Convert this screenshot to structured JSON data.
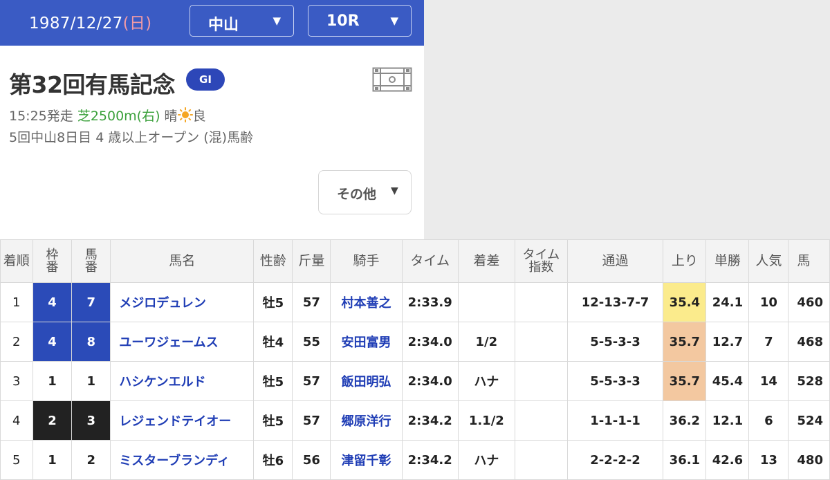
{
  "header": {
    "date": "1987/12/27",
    "day_of_week": "(日)",
    "venue": "中山",
    "race_no": "10R"
  },
  "race": {
    "name": "第32回有馬記念",
    "grade": "GI",
    "start": "15:25発走",
    "course": "芝2500m(右)",
    "weather": "晴",
    "going": "良",
    "meeting": "5回中山8日目 4 歳以上オープン (混)馬齢",
    "other_button": "その他",
    "icons": {
      "video": "film-icon",
      "weather": "sun-icon"
    }
  },
  "table": {
    "headers": [
      "着順",
      "枠番",
      "馬番",
      "馬名",
      "性齢",
      "斤量",
      "騎手",
      "タイム",
      "着差",
      "タイム指数",
      "通過",
      "上り",
      "単勝",
      "人気",
      "馬"
    ],
    "rows": [
      {
        "rank": "1",
        "waku": "4",
        "umaban": "7",
        "horse": "メジロデュレン",
        "sexage": "牡5",
        "weight": "57",
        "jockey": "村本善之",
        "time": "2:33.9",
        "margin": "",
        "index": "",
        "passing": "12-13-7-7",
        "last3f": "35.4",
        "odds": "24.1",
        "popularity": "10",
        "body": "460"
      },
      {
        "rank": "2",
        "waku": "4",
        "umaban": "8",
        "horse": "ユーワジェームス",
        "sexage": "牡4",
        "weight": "55",
        "jockey": "安田富男",
        "time": "2:34.0",
        "margin": "1/2",
        "index": "",
        "passing": "5-5-3-3",
        "last3f": "35.7",
        "odds": "12.7",
        "popularity": "7",
        "body": "468"
      },
      {
        "rank": "3",
        "waku": "1",
        "umaban": "1",
        "horse": "ハシケンエルド",
        "sexage": "牡5",
        "weight": "57",
        "jockey": "飯田明弘",
        "time": "2:34.0",
        "margin": "ハナ",
        "index": "",
        "passing": "5-5-3-3",
        "last3f": "35.7",
        "odds": "45.4",
        "popularity": "14",
        "body": "528"
      },
      {
        "rank": "4",
        "waku": "2",
        "umaban": "3",
        "horse": "レジェンドテイオー",
        "sexage": "牡5",
        "weight": "57",
        "jockey": "郷原洋行",
        "time": "2:34.2",
        "margin": "1.1/2",
        "index": "",
        "passing": "1-1-1-1",
        "last3f": "36.2",
        "odds": "12.1",
        "popularity": "6",
        "body": "524"
      },
      {
        "rank": "5",
        "waku": "1",
        "umaban": "2",
        "horse": "ミスターブランディ",
        "sexage": "牡6",
        "weight": "56",
        "jockey": "津留千彰",
        "time": "2:34.2",
        "margin": "ハナ",
        "index": "",
        "passing": "2-2-2-2",
        "last3f": "36.1",
        "odds": "42.6",
        "popularity": "13",
        "body": "480"
      }
    ]
  },
  "colors": {
    "header_bg": "#3a5bc4",
    "grade_bg": "#2d47b8",
    "waku_4": "#2b4bb8",
    "waku_2": "#222222",
    "last3f_1st": "#fbeb8c",
    "last3f_2nd": "#f3c8a0",
    "link": "#1f3db5",
    "course": "#3aa03a"
  }
}
